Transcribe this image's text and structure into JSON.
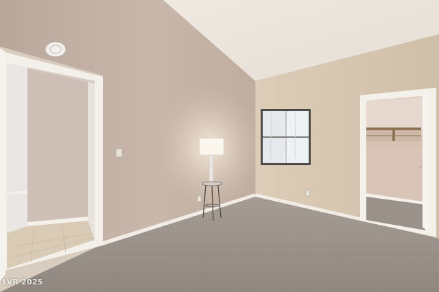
{
  "watermark": "LVR 2025",
  "colors": {
    "left_wall": "#c4b3a6",
    "right_wall": "#d6c6b0",
    "ceiling": "#ece6df",
    "carpet": "#9c948c",
    "trim": "#f4f0ea",
    "tile": "#d9cbb6",
    "window_glass": "#f2f4f6"
  }
}
